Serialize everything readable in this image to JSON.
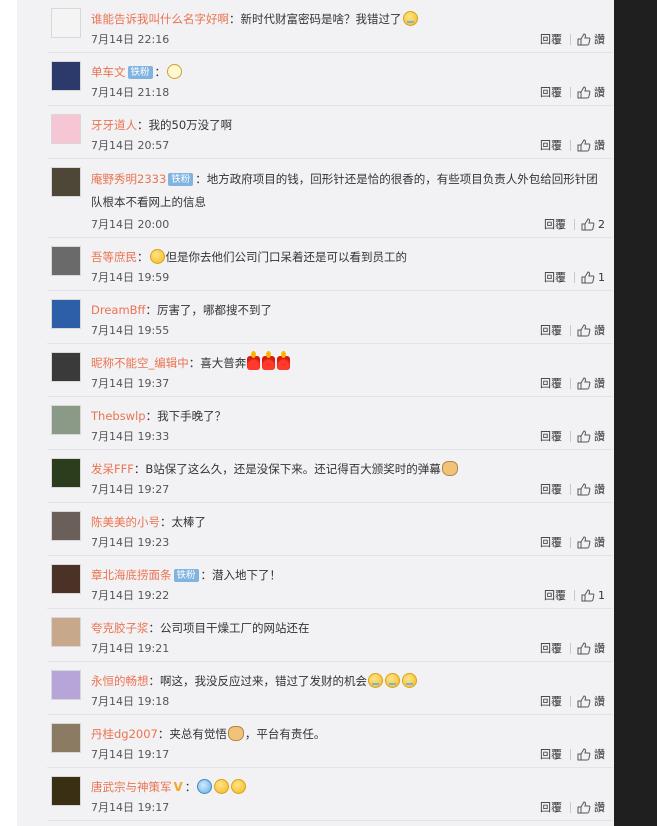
{
  "reply_label": "回覆",
  "comments": [
    {
      "name": "谁能告诉我叫什么名字好啊",
      "badge": "",
      "vip": "",
      "sep": "：",
      "text": "新时代财富密码是啥？我错过了",
      "emoji_after": [
        "cry"
      ],
      "time": "7月14日 22:16",
      "like": "讚",
      "avatar_color": "#f4f4f4"
    },
    {
      "name": "单车文",
      "badge": "铁粉",
      "vip": "",
      "sep": "：",
      "text": "",
      "emoji_after": [
        "glasses"
      ],
      "time": "7月14日 21:18",
      "like": "讚",
      "avatar_color": "#2b3a6b"
    },
    {
      "name": "牙牙道人",
      "badge": "",
      "vip": "",
      "sep": "：",
      "text": "我的50万没了啊",
      "emoji_after": [],
      "time": "7月14日 20:57",
      "like": "讚",
      "avatar_color": "#f7c6d4"
    },
    {
      "name": "庵野秀明2333",
      "badge": "铁粉",
      "vip": "",
      "sep": "：",
      "text": "地方政府项目的钱，回形针还是恰的很香的，有些项目负责人外包给回形针团队根本不看网上的信息",
      "emoji_after": [],
      "time": "7月14日 20:00",
      "like": "2",
      "avatar_color": "#4e4636"
    },
    {
      "name": "吾等庶民",
      "badge": "",
      "vip": "",
      "sep": "：",
      "text_prefix_emoji": "yellow",
      "text": "但是你去他们公司门口呆着还是可以看到员工的",
      "emoji_after": [],
      "time": "7月14日 19:59",
      "like": "1",
      "avatar_color": "#6a6a6a"
    },
    {
      "name": "DreamBff",
      "badge": "",
      "vip": "",
      "sep": "：",
      "text": "厉害了，哪都搜不到了",
      "emoji_after": [],
      "time": "7月14日 19:55",
      "like": "讚",
      "avatar_color": "#2d5fa8"
    },
    {
      "name": "昵称不能空_编辑中",
      "badge": "",
      "vip": "",
      "sep": "：",
      "text": "喜大普奔",
      "emoji_after": [
        "candle",
        "candle",
        "candle"
      ],
      "time": "7月14日 19:37",
      "like": "讚",
      "avatar_color": "#3a3a3a"
    },
    {
      "name": "Thebswlp",
      "badge": "",
      "vip": "",
      "sep": "：",
      "text": "我下手晚了？",
      "emoji_after": [],
      "time": "7月14日 19:33",
      "like": "讚",
      "avatar_color": "#8a9a86"
    },
    {
      "name": "发呆FFF",
      "badge": "",
      "vip": "",
      "sep": "：",
      "text": "B站保了这么久，还是没保下来。还记得百大颁奖时的弹幕",
      "emoji_after": [
        "cat"
      ],
      "time": "7月14日 19:27",
      "like": "讚",
      "avatar_color": "#2b3d1c"
    },
    {
      "name": "陈美美的小号",
      "badge": "",
      "vip": "",
      "sep": "：",
      "text": "太棒了",
      "emoji_after": [],
      "time": "7月14日 19:23",
      "like": "讚",
      "avatar_color": "#6b5f5a"
    },
    {
      "name": "章北海底捞面条",
      "badge": "铁粉",
      "vip": "",
      "sep": "：",
      "text": "潜入地下了！",
      "emoji_after": [],
      "time": "7月14日 19:22",
      "like": "1",
      "avatar_color": "#4a3326"
    },
    {
      "name": "夸克胶子浆",
      "badge": "",
      "vip": "",
      "sep": "：",
      "text": "公司项目干燥工厂的网站还在",
      "emoji_after": [],
      "time": "7月14日 19:21",
      "like": "讚",
      "avatar_color": "#c7a88b"
    },
    {
      "name": "永恒的畅想",
      "badge": "",
      "vip": "",
      "sep": "：",
      "text": "啊这，我没反应过来，错过了发财的机会",
      "emoji_after": [
        "cry",
        "cry",
        "cry"
      ],
      "time": "7月14日 19:18",
      "like": "讚",
      "avatar_color": "#b7a4d9"
    },
    {
      "name": "丹桂dg2007",
      "badge": "",
      "vip": "",
      "sep": "：",
      "text": "夹总有觉悟",
      "text_suffix": "，平台有责任。",
      "emoji_after": [
        "cat"
      ],
      "time": "7月14日 19:17",
      "like": "讚",
      "avatar_color": "#8b7b63"
    },
    {
      "name": "唐武宗与神策军",
      "badge": "",
      "vip": "V",
      "sep": "：",
      "text": "",
      "emoji_after": [
        "blue",
        "laugh",
        "laugh"
      ],
      "time": "7月14日 19:17",
      "like": "讚",
      "avatar_color": "#3a2f12"
    }
  ]
}
